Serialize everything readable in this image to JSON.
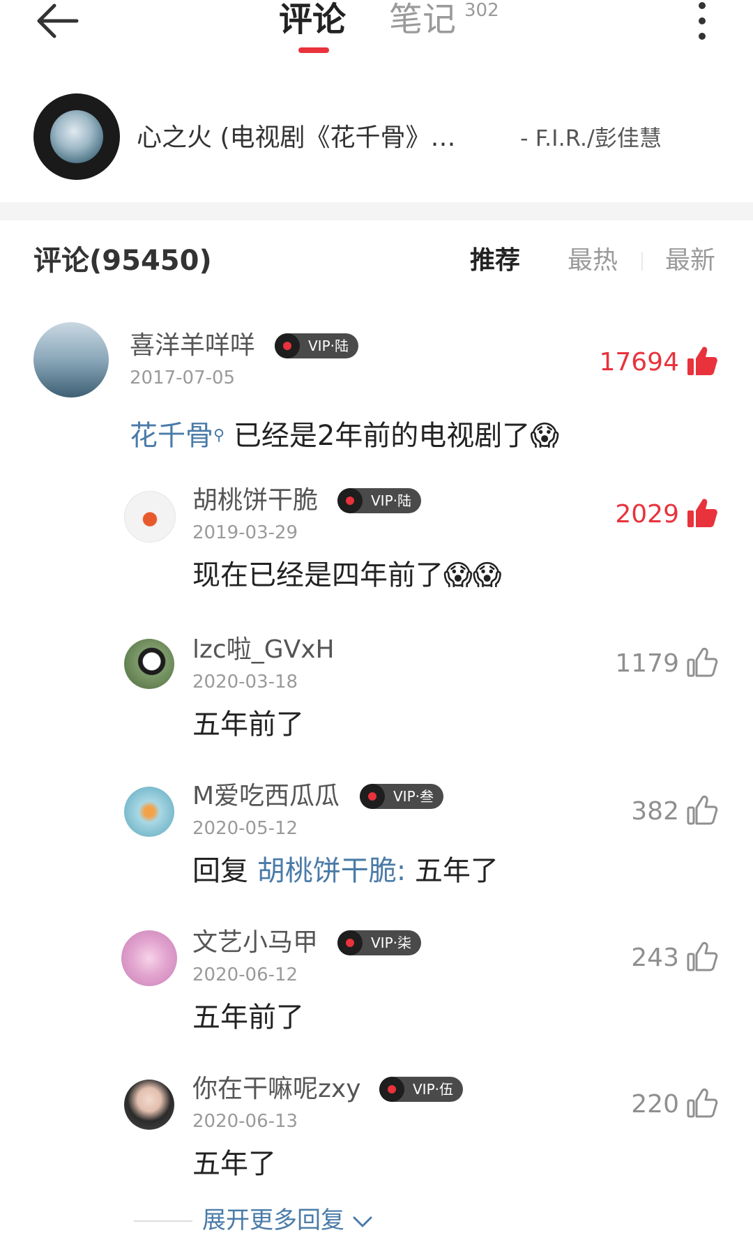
{
  "header": {
    "tab_comments": "评论",
    "tab_notes": "笔记",
    "notes_count": "302"
  },
  "song": {
    "title": "心之火 (电视剧《花千骨》…",
    "artist": "- F.I.R./彭佳慧"
  },
  "comments_header": {
    "count_label": "评论(95450)",
    "sort_options": [
      "推荐",
      "最热",
      "最新"
    ],
    "active_sort": "推荐"
  },
  "comments": [
    {
      "user": "喜洋羊咩咩",
      "vip": "VIP·陆",
      "date": "2017-07-05",
      "likes": "17694",
      "liked": true,
      "topic": "花千骨",
      "text": "已经是2年前的电视剧了😱"
    }
  ],
  "replies": [
    {
      "user": "胡桃饼干脆",
      "vip": "VIP·陆",
      "date": "2019-03-29",
      "likes": "2029",
      "liked": true,
      "text": "现在已经是四年前了😱😱"
    },
    {
      "user": "lzc啦_GVxH",
      "vip": "",
      "date": "2020-03-18",
      "likes": "1179",
      "liked": false,
      "text": "五年前了"
    },
    {
      "user": "M爱吃西瓜瓜",
      "vip": "VIP·叁",
      "date": "2020-05-12",
      "likes": "382",
      "liked": false,
      "reply_prefix": "回复",
      "reply_to": "胡桃饼干脆:",
      "text": "五年了"
    },
    {
      "user": "文艺小马甲",
      "vip": "VIP·柒",
      "date": "2020-06-12",
      "likes": "243",
      "liked": false,
      "text": "五年前了"
    },
    {
      "user": "你在干嘛呢zxy",
      "vip": "VIP·伍",
      "date": "2020-06-13",
      "likes": "220",
      "liked": false,
      "text": "五年了"
    }
  ],
  "expand_more": "展开更多回复",
  "icons": {
    "back": "back-arrow-icon",
    "more": "more-vertical-icon",
    "like": "thumbs-up-icon",
    "vinyl": "vinyl-disc-icon",
    "chevron": "chevron-down-icon"
  },
  "colors": {
    "accent": "#e8323c",
    "link": "#4a7ba8",
    "muted": "#9a9a9a"
  }
}
